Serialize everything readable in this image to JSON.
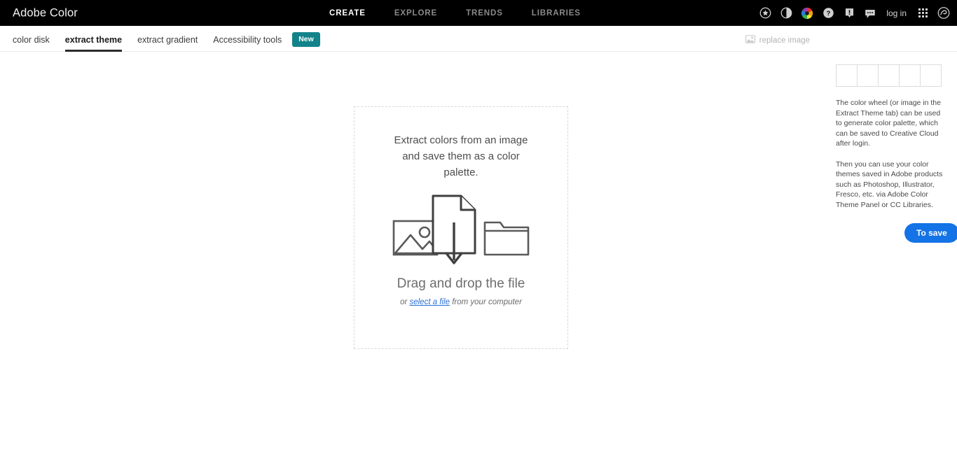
{
  "header": {
    "brand": "Adobe Color",
    "nav": [
      {
        "label": "CREATE",
        "active": true
      },
      {
        "label": "EXPLORE",
        "active": false
      },
      {
        "label": "TRENDS",
        "active": false
      },
      {
        "label": "LIBRARIES",
        "active": false
      }
    ],
    "login_label": "log in",
    "icons": [
      "star-icon",
      "contrast-icon",
      "color-wheel-icon",
      "help-icon",
      "feedback-icon",
      "chat-icon",
      "app-grid-icon",
      "creative-cloud-icon"
    ],
    "background_color": "#000000"
  },
  "tabs": {
    "items": [
      {
        "label": "color disk",
        "active": false
      },
      {
        "label": "extract theme",
        "active": true
      },
      {
        "label": "extract gradient",
        "active": false
      },
      {
        "label": "Accessibility tools",
        "active": false
      }
    ],
    "badge_label": "New",
    "badge_color": "#12838a",
    "replace_image_label": "replace image"
  },
  "dropzone": {
    "headline": "Extract colors from an image and save them as a color palette.",
    "title": "Drag and drop the file",
    "sub_prefix": "or ",
    "sub_link": "select a file",
    "sub_suffix": " from your computer",
    "illustration": [
      "image-icon",
      "document-download-icon",
      "folder-icon"
    ]
  },
  "rail": {
    "swatch_count": 5,
    "paragraph_one": "The color wheel (or image in the Extract Theme tab) can be used to generate color palette, which can be saved to Creative Cloud after login.",
    "paragraph_two": "Then you can use your color themes saved in Adobe products such as Photoshop, Illustrator, Fresco, etc. via Adobe Color Theme Panel or CC Libraries.",
    "save_label": "To save",
    "save_color": "#1473e6"
  }
}
